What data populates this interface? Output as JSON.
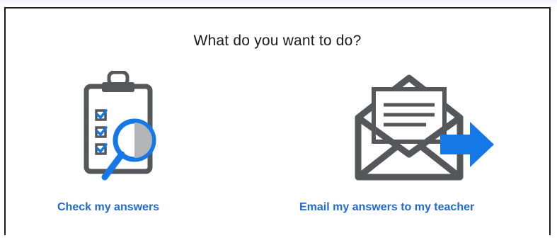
{
  "dialog": {
    "title": "What do you want to do?"
  },
  "options": [
    {
      "label": "Check my answers",
      "icon": "clipboard-magnifier-icon"
    },
    {
      "label": "Email my answers to my teacher",
      "icon": "envelope-send-icon"
    }
  ],
  "colors": {
    "link": "#1e6ad1",
    "accent_blue": "#1479e6",
    "icon_gray": "#55575a",
    "title_text": "#1a1a1a"
  }
}
